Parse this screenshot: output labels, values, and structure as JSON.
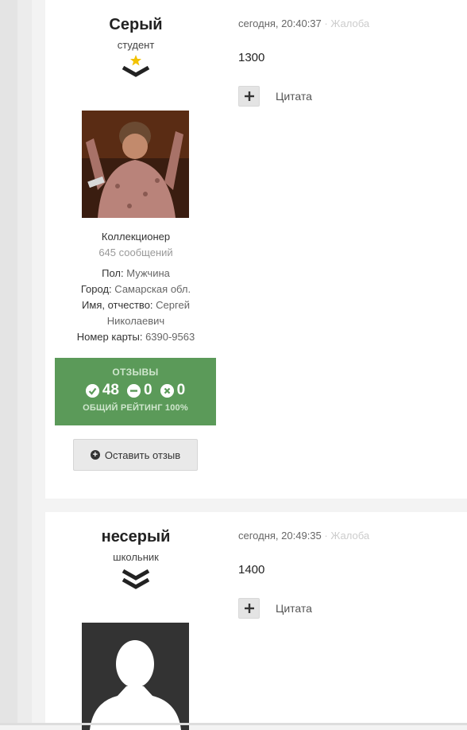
{
  "posts": [
    {
      "author": {
        "name": "Серый",
        "rank": "студент",
        "rank_icon": "star-single-chevron-icon"
      },
      "timestamp": "сегодня, 20:40:37",
      "separator": "·",
      "report_label": "Жалоба",
      "content": "1300",
      "quote_label": "Цитата",
      "avatar": "avatar-photo",
      "group": "Коллекционер",
      "post_count": "645 сообщений",
      "fields": [
        {
          "label": "Пол:",
          "value": "Мужчина"
        },
        {
          "label": "Город:",
          "value": "Самарская обл."
        },
        {
          "label": "Имя, отчество:",
          "value": "Сергей Николаевич"
        },
        {
          "label": "Номер карты:",
          "value": "6390-9563"
        }
      ],
      "feedback": {
        "title": "ОТЗЫВЫ",
        "positive": "48",
        "neutral": "0",
        "negative": "0",
        "rating": "ОБЩИЙ РЕЙТИНГ 100%",
        "color": "#5b9a59"
      },
      "leave_feedback_label": "Оставить отзыв"
    },
    {
      "author": {
        "name": "несерый",
        "rank": "школьник",
        "rank_icon": "double-chevron-icon"
      },
      "timestamp": "сегодня, 20:49:35",
      "separator": "·",
      "report_label": "Жалоба",
      "content": "1400",
      "quote_label": "Цитата",
      "avatar": "default-avatar-silhouette"
    }
  ]
}
